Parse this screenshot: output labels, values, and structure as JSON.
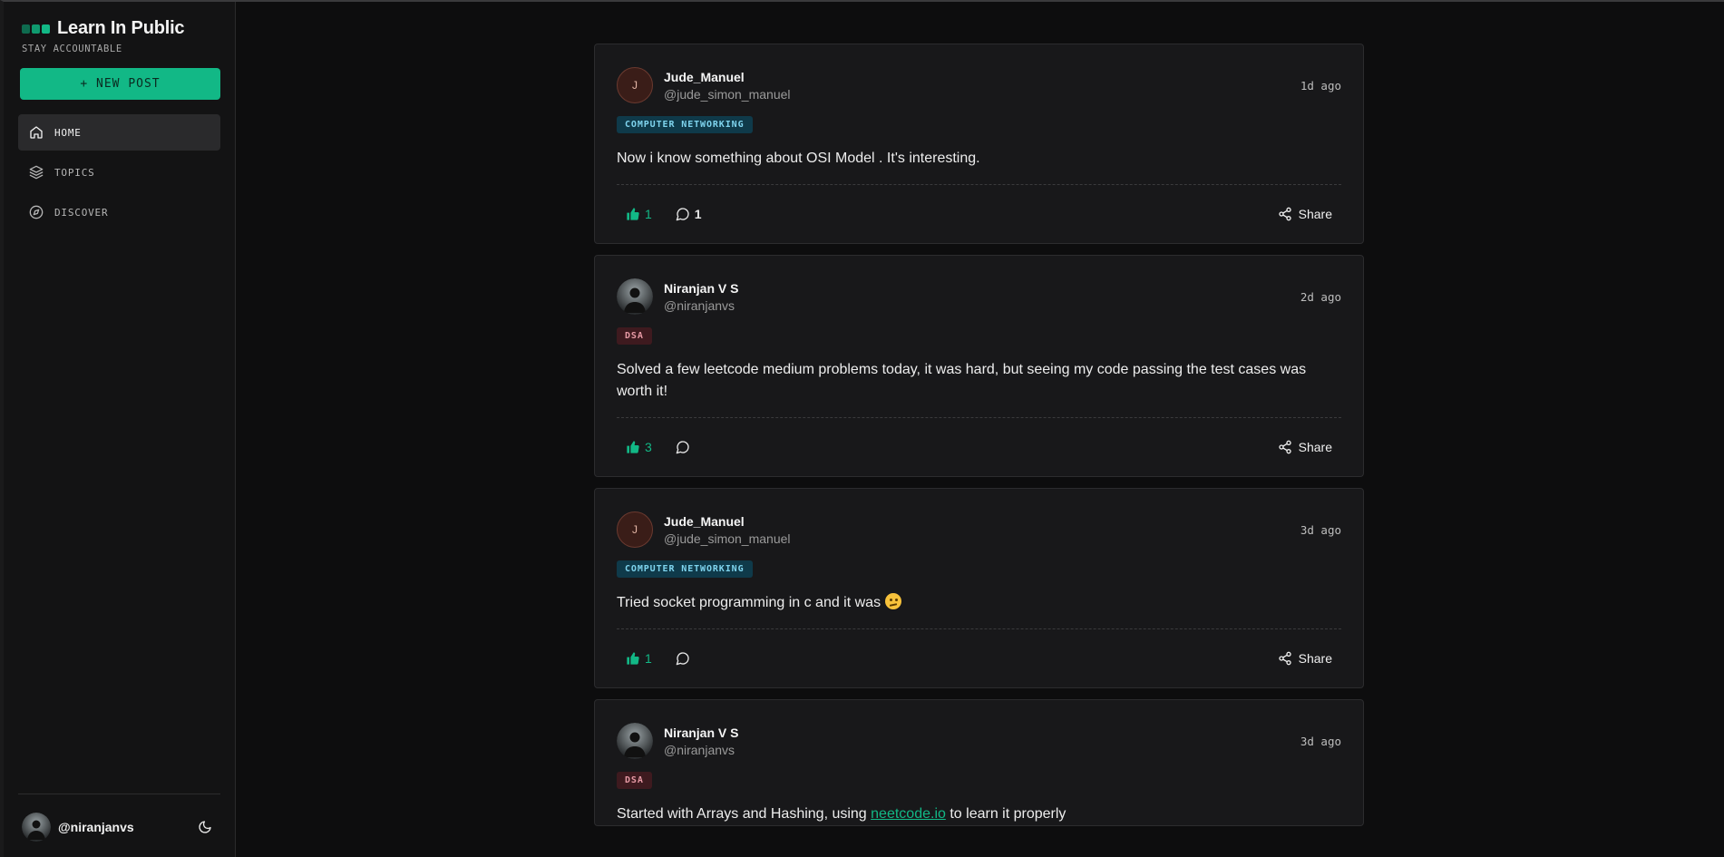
{
  "app": {
    "title": "Learn In Public",
    "tagline": "STAY ACCOUNTABLE",
    "new_post_label": "+ NEW POST",
    "logo_colors": [
      "#0e6b4f",
      "#0f9a6f",
      "#12b886"
    ]
  },
  "nav": [
    {
      "label": "HOME",
      "icon": "home-icon",
      "active": true
    },
    {
      "label": "TOPICS",
      "icon": "layers-icon",
      "active": false
    },
    {
      "label": "DISCOVER",
      "icon": "compass-icon",
      "active": false
    }
  ],
  "current_user": {
    "handle": "@niranjanvs",
    "theme_icon": "moon-icon"
  },
  "colors": {
    "accent": "#12b886",
    "background": "#0d0d0e",
    "card": "#18181a"
  },
  "posts": [
    {
      "name": "Jude_Manuel",
      "handle": "@jude_simon_manuel",
      "avatar_letter": "J",
      "time": "1d ago",
      "tag": "COMPUTER NETWORKING",
      "text": "Now i know something about OSI Model . It's interesting.",
      "likes": "1",
      "comments": "1",
      "share": "Share"
    },
    {
      "name": "Niranjan V S",
      "handle": "@niranjanvs",
      "avatar_letter": "",
      "time": "2d ago",
      "tag": "DSA",
      "text": "Solved a few leetcode medium problems today, it was hard, but seeing my code passing the test cases was worth it!",
      "likes": "3",
      "comments": "",
      "share": "Share"
    },
    {
      "name": "Jude_Manuel",
      "handle": "@jude_simon_manuel",
      "avatar_letter": "J",
      "time": "3d ago",
      "tag": "COMPUTER NETWORKING",
      "text": "Tried socket programming in c and it was",
      "emoji": "confused-face-emoji",
      "likes": "1",
      "comments": "",
      "share": "Share"
    },
    {
      "name": "Niranjan V S",
      "handle": "@niranjanvs",
      "avatar_letter": "",
      "time": "3d ago",
      "tag": "DSA",
      "text_before": "Started with Arrays and Hashing, using",
      "link": "neetcode.io",
      "text_after": "to learn it properly"
    }
  ]
}
